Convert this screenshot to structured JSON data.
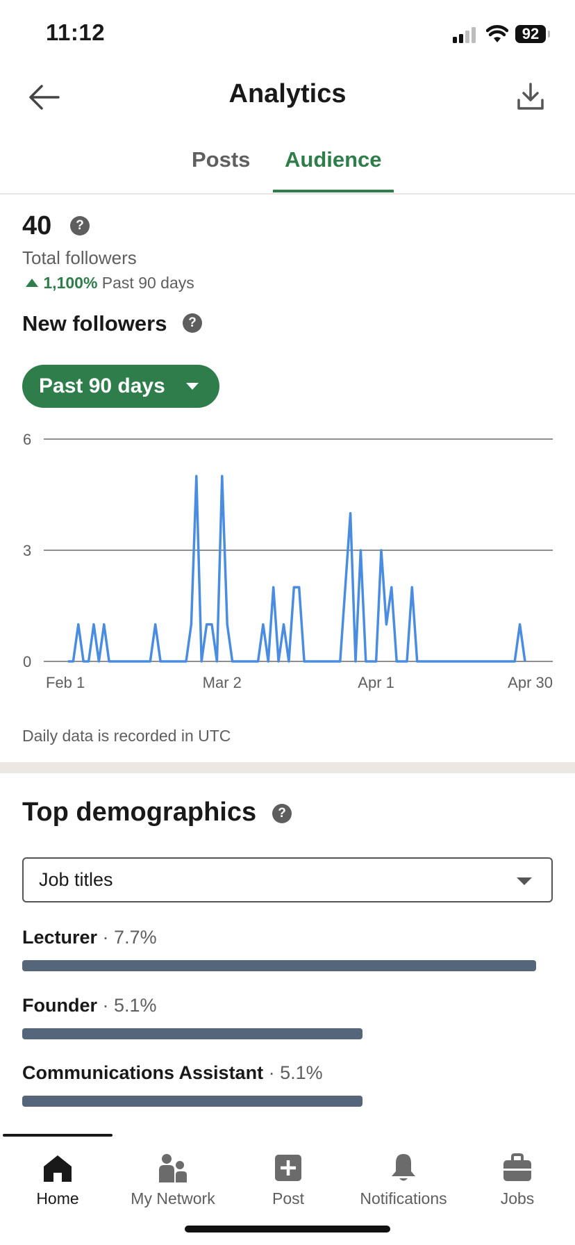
{
  "status_bar": {
    "time": "11:12",
    "battery": "92"
  },
  "header": {
    "title": "Analytics",
    "back_icon": "arrow-left-icon",
    "download_icon": "download-icon"
  },
  "tabs": [
    {
      "label": "Posts",
      "active": false
    },
    {
      "label": "Audience",
      "active": true
    }
  ],
  "summary": {
    "total": "40",
    "total_label": "Total followers",
    "change": "1,100%",
    "change_period": "Past 90 days"
  },
  "new_followers": {
    "title": "New followers",
    "range_label": "Past 90 days",
    "note": "Daily data is recorded in UTC"
  },
  "chart_data": {
    "type": "line",
    "title": "",
    "xlabel": "",
    "ylabel": "",
    "ylim": [
      0,
      6
    ],
    "y_ticks": [
      "0",
      "3",
      "6"
    ],
    "x_ticks": [
      "Feb 1",
      "Mar 2",
      "Apr 1",
      "Apr 30"
    ],
    "x_tick_day_index": [
      0,
      30,
      60,
      89
    ],
    "grid": true,
    "color": "#4a8ce0",
    "values": [
      0,
      0,
      1,
      0,
      0,
      1,
      0,
      1,
      0,
      0,
      0,
      0,
      0,
      0,
      0,
      0,
      0,
      1,
      0,
      0,
      0,
      0,
      0,
      0,
      1,
      5,
      0,
      1,
      1,
      0,
      5,
      1,
      0,
      0,
      0,
      0,
      0,
      0,
      1,
      0,
      2,
      0,
      1,
      0,
      2,
      2,
      0,
      0,
      0,
      0,
      0,
      0,
      0,
      0,
      2,
      4,
      0,
      3,
      0,
      0,
      0,
      3,
      1,
      2,
      0,
      0,
      0,
      2,
      0,
      0,
      0,
      0,
      0,
      0,
      0,
      0,
      0,
      0,
      0,
      0,
      0,
      0,
      0,
      0,
      0,
      0,
      0,
      0,
      1,
      0
    ]
  },
  "demographics": {
    "title": "Top demographics",
    "selector": "Job titles",
    "items": [
      {
        "label": "Lecturer",
        "pct": "7.7%",
        "value": 7.7
      },
      {
        "label": "Founder",
        "pct": "5.1%",
        "value": 5.1
      },
      {
        "label": "Communications Assistant",
        "pct": "5.1%",
        "value": 5.1
      }
    ]
  },
  "bottom_nav": [
    {
      "label": "Home",
      "icon": "home-icon",
      "active": true
    },
    {
      "label": "My Network",
      "icon": "network-icon",
      "active": false
    },
    {
      "label": "Post",
      "icon": "post-plus-icon",
      "active": false
    },
    {
      "label": "Notifications",
      "icon": "bell-icon",
      "active": false
    },
    {
      "label": "Jobs",
      "icon": "briefcase-icon",
      "active": false
    }
  ]
}
